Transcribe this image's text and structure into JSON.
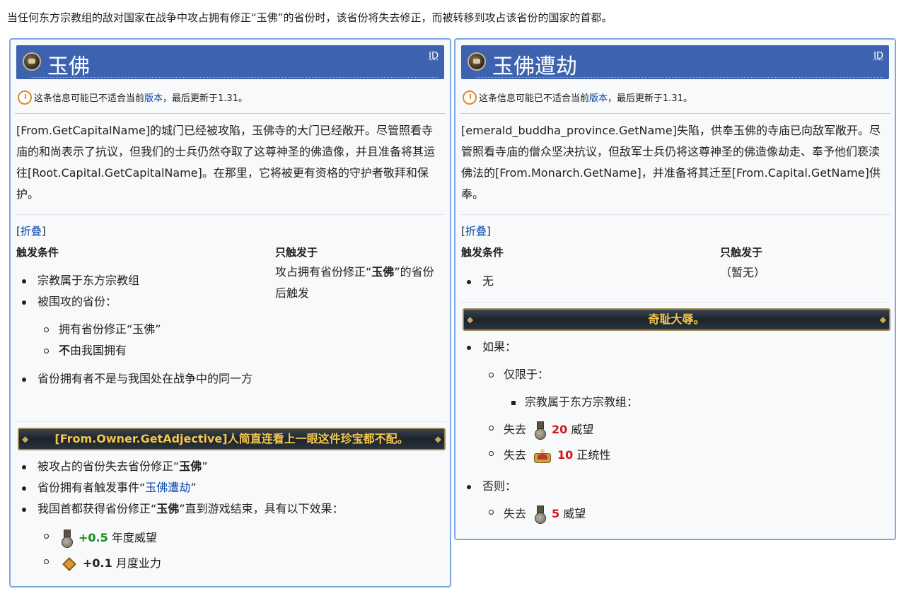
{
  "intro": "当任何东方宗教组的敌对国家在战争中攻占拥有修正“玉佛”的省份时，该省份将失去修正，而被转移到攻占该省份的国家的首都。",
  "common": {
    "id_label": "ID",
    "notice_pre": "这条信息可能已不适合当前",
    "notice_link": "版本",
    "notice_post": "，最后更新于1.31。",
    "fold_open": "[",
    "fold_label": "折叠",
    "fold_close": "]",
    "trigger_heading": "触发条件",
    "only_heading": "只触发于"
  },
  "left": {
    "title": "玉佛",
    "description": "[From.GetCapitalName]的城门已经被攻陷，玉佛寺的大门已经敞开。尽管照看寺庙的和尚表示了抗议，但我们的士兵仍然夺取了这尊神圣的佛造像，并且准备将其运往[Root.Capital.GetCapitalName]。在那里，它将被更有资格的守护者敬拜和保护。",
    "only_pre": "攻占拥有省份修正“",
    "only_bold": "玉佛",
    "only_post": "”的省份后触发",
    "conditions": {
      "c1": "宗教属于东方宗教组",
      "c2": "被围攻的省份：",
      "c2a": "拥有省份修正“玉佛”",
      "c2b_bold": "不",
      "c2b_rest": "由我国拥有",
      "c3": "省份拥有者不是与我国处在战争中的同一方"
    },
    "banner": "[From.Owner.GetAdjective]人简直连看上一眼这件珍宝都不配。",
    "effects": {
      "e1_pre": "被攻占的省份失去省份修正“",
      "e1_bold": "玉佛",
      "e1_post": "”",
      "e2_pre": "省份拥有者触发事件“",
      "e2_link": "玉佛遭劫",
      "e2_post": "”",
      "e3_pre": "我国首都获得省份修正“",
      "e3_bold": "玉佛",
      "e3_post": "”直到游戏结束，具有以下效果：",
      "m1_icon": "prestige-medal-icon",
      "m1_value": "+0.5",
      "m1_label": "年度威望",
      "m2_icon": "karma-knot-icon",
      "m2_value": "+0.1",
      "m2_label": "月度业力"
    }
  },
  "right": {
    "title": "玉佛遭劫",
    "description": "[emerald_buddha_province.GetName]失陷，供奉玉佛的寺庙已向敌军敞开。尽管照看寺庙的僧众坚决抗议，但敌军士兵仍将这尊神圣的佛造像劫走、奉予他们亵渎佛法的[From.Monarch.GetName]，并准备将其迁至[From.Capital.GetName]供奉。",
    "only_text": "（暂无）",
    "cond_none": "无",
    "banner": "奇耻大辱。",
    "options": {
      "if_label": "如果：",
      "limit_label": "仅限于：",
      "limit_item": "宗教属于东方宗教组：",
      "lose": "失去",
      "o1_icon": "prestige-medal-icon",
      "o1_value": "20",
      "o1_label": "威望",
      "o2_icon": "legitimacy-crown-icon",
      "o2_value": "10",
      "o2_label": "正统性",
      "else_label": "否则：",
      "o3_icon": "prestige-medal-icon",
      "o3_value": "5",
      "o3_label": "威望"
    }
  },
  "colors": {
    "header_bg": "#3d63b0",
    "card_border": "#7ea6e0",
    "positive": "#1a8a1a",
    "negative": "#d4161b",
    "banner_text": "#f4c74a",
    "link": "#0645ad"
  }
}
